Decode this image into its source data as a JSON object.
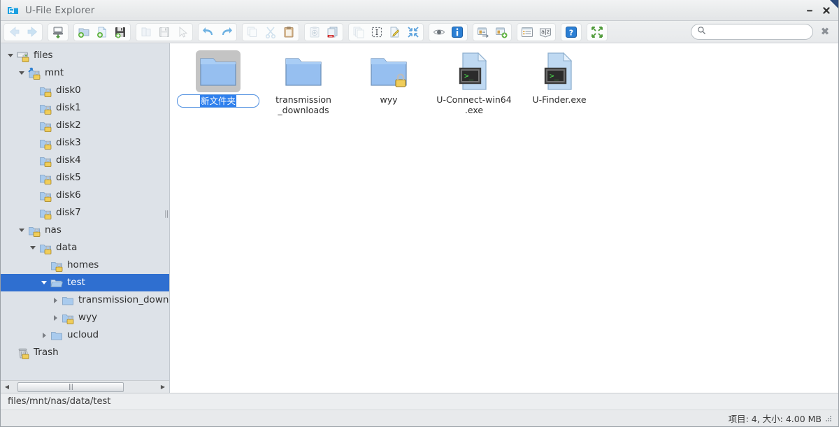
{
  "window": {
    "title": "U-File Explorer",
    "icon": "app-folder-icon",
    "minimize_label": "Minimize",
    "close_label": "Close"
  },
  "toolbar": {
    "groups": [
      {
        "name": "navigation",
        "buttons": [
          {
            "name": "back-button",
            "icon": "arrow-left-icon",
            "label": "Back",
            "disabled": true
          },
          {
            "name": "forward-button",
            "icon": "arrow-right-icon",
            "label": "Forward",
            "disabled": true
          }
        ]
      },
      {
        "name": "mount",
        "buttons": [
          {
            "name": "mount-device-button",
            "icon": "server-icon",
            "label": "Mount",
            "disabled": false
          }
        ]
      },
      {
        "name": "create",
        "buttons": [
          {
            "name": "new-folder-button",
            "icon": "new-folder-icon",
            "label": "New Folder",
            "disabled": false
          },
          {
            "name": "new-file-button",
            "icon": "new-file-icon",
            "label": "New File",
            "disabled": false
          },
          {
            "name": "save-button",
            "icon": "floppy-save-icon",
            "label": "Save",
            "disabled": false
          }
        ]
      },
      {
        "name": "file-ops",
        "buttons": [
          {
            "name": "open-folder-button",
            "icon": "open-folder-icon",
            "label": "Open",
            "disabled": true
          },
          {
            "name": "save-as-button",
            "icon": "floppy-icon",
            "label": "Save As",
            "disabled": true
          },
          {
            "name": "select-pointer-button",
            "icon": "cursor-arrow-icon",
            "label": "Select",
            "disabled": true
          }
        ]
      },
      {
        "name": "history",
        "buttons": [
          {
            "name": "undo-button",
            "icon": "undo-arrow-icon",
            "label": "Undo",
            "disabled": false
          },
          {
            "name": "redo-button",
            "icon": "redo-arrow-icon",
            "label": "Redo",
            "disabled": false
          }
        ]
      },
      {
        "name": "clipboard",
        "buttons": [
          {
            "name": "copy-button",
            "icon": "copy-icon",
            "label": "Copy",
            "disabled": true
          },
          {
            "name": "cut-button",
            "icon": "scissors-icon",
            "label": "Cut",
            "disabled": true
          },
          {
            "name": "paste-button",
            "icon": "clipboard-icon",
            "label": "Paste",
            "disabled": false
          }
        ]
      },
      {
        "name": "transfer",
        "buttons": [
          {
            "name": "paste-special-button",
            "icon": "clipboard-move-icon",
            "label": "Paste Special",
            "disabled": true
          },
          {
            "name": "delete-button",
            "icon": "delete-file-icon",
            "label": "Delete",
            "disabled": false
          }
        ]
      },
      {
        "name": "edit",
        "buttons": [
          {
            "name": "duplicate-button",
            "icon": "duplicate-icon",
            "label": "Duplicate",
            "disabled": true
          },
          {
            "name": "select-all-button",
            "icon": "select-all-icon",
            "label": "Select All",
            "disabled": false
          },
          {
            "name": "rename-button",
            "icon": "rename-pencil-icon",
            "label": "Rename",
            "disabled": false
          },
          {
            "name": "expand-button",
            "icon": "arrows-in-icon",
            "label": "Expand",
            "disabled": false
          }
        ]
      },
      {
        "name": "view",
        "buttons": [
          {
            "name": "show-hidden-button",
            "icon": "eye-icon",
            "label": "Show Hidden",
            "disabled": false
          },
          {
            "name": "properties-button",
            "icon": "info-icon",
            "label": "Properties",
            "disabled": false
          }
        ]
      },
      {
        "name": "share",
        "buttons": [
          {
            "name": "share-button",
            "icon": "share-window-icon",
            "label": "Share",
            "disabled": false
          },
          {
            "name": "add-share-button",
            "icon": "add-share-icon",
            "label": "Add Share",
            "disabled": false
          }
        ]
      },
      {
        "name": "list",
        "buttons": [
          {
            "name": "list-view-button",
            "icon": "list-view-icon",
            "label": "List View",
            "disabled": false
          },
          {
            "name": "sort-button",
            "icon": "sort-az-icon",
            "label": "Sort",
            "disabled": false
          }
        ]
      },
      {
        "name": "help",
        "buttons": [
          {
            "name": "help-button",
            "icon": "question-mark-icon",
            "label": "Help",
            "disabled": false
          }
        ]
      },
      {
        "name": "fullscreen",
        "buttons": [
          {
            "name": "fullscreen-button",
            "icon": "arrows-out-icon",
            "label": "Fullscreen",
            "disabled": false
          }
        ]
      }
    ]
  },
  "search": {
    "placeholder": "",
    "value": "",
    "icon": "search-icon",
    "clear_label": "✖"
  },
  "sidebar": {
    "items": [
      {
        "label": "files",
        "indent": 0,
        "twisty": "open",
        "icon": "server-locked-icon",
        "selected": false
      },
      {
        "label": "mnt",
        "indent": 1,
        "twisty": "open",
        "icon": "folder-link-locked-icon",
        "selected": false
      },
      {
        "label": "disk0",
        "indent": 2,
        "twisty": "none",
        "icon": "folder-locked-icon",
        "selected": false
      },
      {
        "label": "disk1",
        "indent": 2,
        "twisty": "none",
        "icon": "folder-locked-icon",
        "selected": false
      },
      {
        "label": "disk2",
        "indent": 2,
        "twisty": "none",
        "icon": "folder-locked-icon",
        "selected": false
      },
      {
        "label": "disk3",
        "indent": 2,
        "twisty": "none",
        "icon": "folder-locked-icon",
        "selected": false
      },
      {
        "label": "disk4",
        "indent": 2,
        "twisty": "none",
        "icon": "folder-locked-icon",
        "selected": false
      },
      {
        "label": "disk5",
        "indent": 2,
        "twisty": "none",
        "icon": "folder-locked-icon",
        "selected": false
      },
      {
        "label": "disk6",
        "indent": 2,
        "twisty": "none",
        "icon": "folder-locked-icon",
        "selected": false
      },
      {
        "label": "disk7",
        "indent": 2,
        "twisty": "none",
        "icon": "folder-locked-icon",
        "selected": false
      },
      {
        "label": "nas",
        "indent": 1,
        "twisty": "open",
        "icon": "folder-locked-icon",
        "selected": false
      },
      {
        "label": "data",
        "indent": 2,
        "twisty": "open",
        "icon": "folder-locked-icon",
        "selected": false
      },
      {
        "label": "homes",
        "indent": 3,
        "twisty": "none",
        "icon": "folder-locked-icon",
        "selected": false
      },
      {
        "label": "test",
        "indent": 3,
        "twisty": "open",
        "icon": "folder-open-icon",
        "selected": true
      },
      {
        "label": "transmission_downloads",
        "indent": 4,
        "twisty": "closed",
        "icon": "folder-icon",
        "selected": false
      },
      {
        "label": "wyy",
        "indent": 4,
        "twisty": "closed",
        "icon": "folder-locked-icon",
        "selected": false
      },
      {
        "label": "ucloud",
        "indent": 3,
        "twisty": "closed",
        "icon": "folder-icon",
        "selected": false
      },
      {
        "label": "Trash",
        "indent": 0,
        "twisty": "none",
        "icon": "trash-locked-icon",
        "selected": false
      }
    ],
    "hscroll": {
      "left_arrow": "◀",
      "right_arrow": "▶",
      "thumb_glyph": "|||"
    }
  },
  "files": {
    "items": [
      {
        "name": "新文件夹",
        "icon": "folder-icon",
        "selected": true,
        "renaming": true,
        "locked": false
      },
      {
        "name": "transmission_downloads",
        "display": "transmission\n_downloads",
        "icon": "folder-icon",
        "selected": false,
        "renaming": false,
        "locked": false
      },
      {
        "name": "wyy",
        "icon": "folder-locked-icon",
        "selected": false,
        "renaming": false,
        "locked": true
      },
      {
        "name": "U-Connect-win64.exe",
        "display": "U-Connect-win64\n.exe",
        "icon": "exe-file-icon",
        "selected": false,
        "renaming": false,
        "locked": false
      },
      {
        "name": "U-Finder.exe",
        "display": "U-Finder.exe",
        "icon": "exe-file-icon",
        "selected": false,
        "renaming": false,
        "locked": false
      }
    ]
  },
  "pathbar": {
    "path": "files/mnt/nas/data/test"
  },
  "statusbar": {
    "text": "项目: 4, 大小: 4.00 MB",
    "grip": "resize-grip-icon"
  },
  "colors": {
    "selection_blue": "#2f6fd0",
    "rename_highlight": "#2f80ed",
    "folder_blue": "#8cb4e8",
    "titlebar_corner": "#2c4a7c",
    "sidebar_bg": "#dde2e8"
  }
}
